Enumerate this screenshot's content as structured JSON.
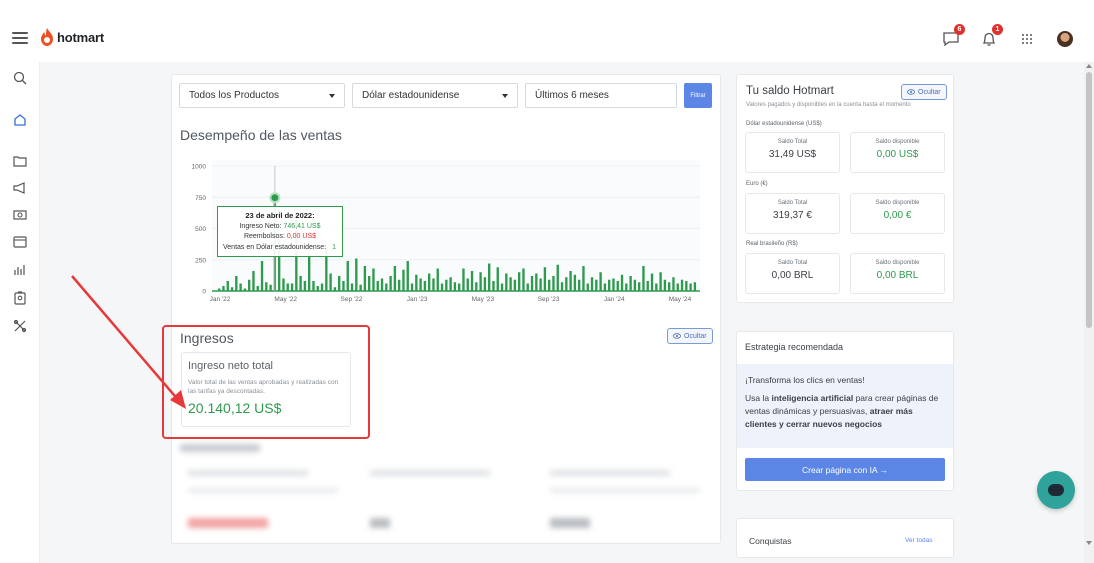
{
  "header": {
    "logo_text": "hotmart",
    "notifications": {
      "messages_badge": "6",
      "alerts_badge": "1"
    }
  },
  "filters": {
    "product": "Todos los Productos",
    "currency": "Dólar estadounidense",
    "period": "Últimos 6 meses",
    "filter_button": "Filtrar"
  },
  "sales": {
    "title": "Desempeño de las ventas",
    "tooltip": {
      "date": "23 de abril de 2022:",
      "net_label": "Ingreso Neto:",
      "net_value": "746,41 US$",
      "refunds_label": "Reembolsos:",
      "refunds_value": "0,00 US$",
      "sales_label": "Ventas en Dólar estadounidense:",
      "sales_value": "1"
    }
  },
  "chart_data": {
    "type": "bar",
    "title": "Desempeño de las ventas",
    "xlabel": "",
    "ylabel": "",
    "ylim": [
      0,
      1000
    ],
    "yticks": [
      0,
      250,
      500,
      750,
      1000
    ],
    "xticks": [
      "Jan '22",
      "May '22",
      "Sep '22",
      "Jan '23",
      "May '23",
      "Sep '23",
      "Jan '24",
      "May '24"
    ],
    "highlight_point": {
      "x": "2022-04-23",
      "y": 746.41
    },
    "series": [
      {
        "values": [
          20,
          40,
          80,
          30,
          120,
          60,
          20,
          90,
          160,
          40,
          240,
          70,
          50,
          746,
          410,
          100,
          60,
          60,
          620,
          120,
          80,
          290,
          80,
          40,
          60,
          360,
          140,
          30,
          120,
          80,
          240,
          60,
          260,
          50,
          200,
          120,
          180,
          80,
          100,
          60,
          120,
          200,
          90,
          170,
          240,
          60,
          130,
          100,
          80,
          140,
          100,
          180,
          60,
          90,
          110,
          70,
          60,
          180,
          100,
          160,
          70,
          150,
          110,
          220,
          80,
          190,
          60,
          140,
          110,
          90,
          150,
          180,
          60,
          120,
          140,
          100,
          190,
          90,
          120,
          210,
          70,
          110,
          160,
          130,
          90,
          200,
          60,
          110,
          90,
          150,
          60,
          90,
          100,
          80,
          130,
          60,
          120,
          90,
          70,
          200,
          80,
          140,
          60,
          150,
          90,
          70,
          110,
          60,
          90,
          80,
          60,
          70
        ]
      }
    ]
  },
  "income": {
    "title": "Ingresos",
    "hide_label": "Ocultar",
    "card_title": "Ingreso neto total",
    "card_desc": "Valor total de las ventas aprobadas y realizadas con las tarifas ya descontadas.",
    "card_value": "20.140,12 US$"
  },
  "balance": {
    "title": "Tu saldo Hotmart",
    "hide_label": "Ocultar",
    "subtitle": "Valores pagados y disponibles en la cuenta hasta el momento",
    "groups": [
      {
        "currency": "Dólar estadounidense (US$)",
        "total_label": "Saldo Total",
        "total": "31,49 US$",
        "available_label": "Saldo disponible",
        "available": "0,00 US$"
      },
      {
        "currency": "Euro (€)",
        "total_label": "Saldo Total",
        "total": "319,37 €",
        "available_label": "Saldo disponible",
        "available": "0,00 €"
      },
      {
        "currency": "Real brasileño (R$)",
        "total_label": "Saldo Total",
        "total": "0,00 BRL",
        "available_label": "Saldo disponible",
        "available": "0,00 BRL"
      }
    ]
  },
  "strategy": {
    "title": "Estrategia recomendada",
    "headline": "¡Transforma los clics en ventas!",
    "body_1": "Usa la ",
    "body_bold_1": "inteligencia artificial",
    "body_2": " para crear páginas de ventas dinámicas y persuasivas, ",
    "body_bold_2": "atraer más clientes y cerrar nuevos negocios",
    "cta": "Crear página con IA →"
  },
  "achievements": {
    "title": "Conquistas",
    "link": "Ver todas"
  },
  "colors": {
    "brand": "#f04e23",
    "accent": "#5b86e5",
    "positive": "#2e9a4e",
    "annotation": "#e63a3a"
  }
}
